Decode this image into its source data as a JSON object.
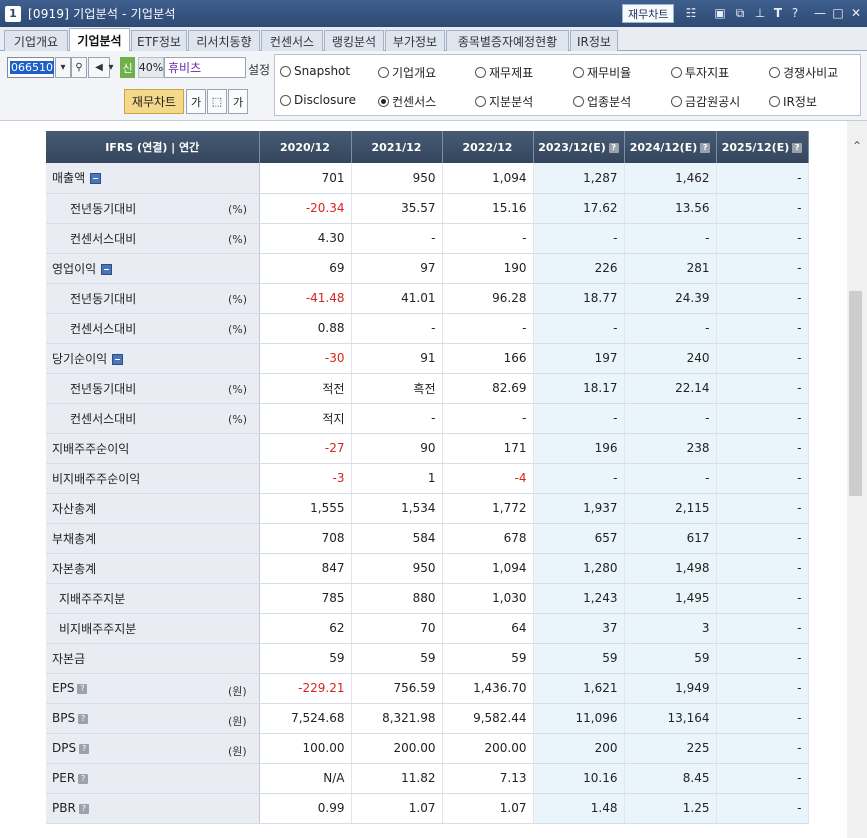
{
  "window": {
    "num": "1",
    "title": "[0919] 기업분석 - 기업분석",
    "chart_button": "재무차트"
  },
  "titlebar_icons": [
    "chart-icon",
    "window-icon",
    "cascade-icon",
    "pin-icon",
    "font-icon",
    "help-icon",
    "minimize-icon",
    "maximize-icon",
    "close-icon"
  ],
  "tabs": [
    "기업개요",
    "기업분석",
    "ETF정보",
    "리서치동향",
    "컨센서스",
    "랭킹분석",
    "부가정보",
    "종목별증자예정현황",
    "IR정보"
  ],
  "active_tab": "기업분석",
  "controls": {
    "code": "066510",
    "new_badge": "신",
    "percent": "40%",
    "stock_name": "휴비츠",
    "setting_label": "설정",
    "fin_chart_button": "재무차트"
  },
  "radios": [
    {
      "label": "Snapshot",
      "selected": false
    },
    {
      "label": "기업개요",
      "selected": false
    },
    {
      "label": "재무제표",
      "selected": false
    },
    {
      "label": "재무비율",
      "selected": false
    },
    {
      "label": "투자지표",
      "selected": false
    },
    {
      "label": "경쟁사비교",
      "selected": false
    },
    {
      "label": "Disclosure",
      "selected": false
    },
    {
      "label": "컨센서스",
      "selected": true
    },
    {
      "label": "지분분석",
      "selected": false
    },
    {
      "label": "업종분석",
      "selected": false
    },
    {
      "label": "금감원공시",
      "selected": false
    },
    {
      "label": "IR정보",
      "selected": false
    }
  ],
  "table": {
    "header_label": "IFRS (연결) | 연간",
    "columns": [
      "2020/12",
      "2021/12",
      "2022/12",
      "2023/12(E)",
      "2024/12(E)",
      "2025/12(E)"
    ],
    "rows": [
      {
        "label": "매출액",
        "indent": 0,
        "unit": "",
        "collapse": true,
        "help": false,
        "values": [
          "701",
          "950",
          "1,094",
          "1,287",
          "1,462",
          "-"
        ]
      },
      {
        "label": "전년동기대비",
        "indent": 2,
        "unit": "(%)",
        "collapse": false,
        "help": false,
        "values": [
          "-20.34",
          "35.57",
          "15.16",
          "17.62",
          "13.56",
          "-"
        ]
      },
      {
        "label": "컨센서스대비",
        "indent": 2,
        "unit": "(%)",
        "collapse": false,
        "help": false,
        "values": [
          "4.30",
          "-",
          "-",
          "-",
          "-",
          "-"
        ]
      },
      {
        "label": "영업이익",
        "indent": 0,
        "unit": "",
        "collapse": true,
        "help": false,
        "values": [
          "69",
          "97",
          "190",
          "226",
          "281",
          "-"
        ]
      },
      {
        "label": "전년동기대비",
        "indent": 2,
        "unit": "(%)",
        "collapse": false,
        "help": false,
        "values": [
          "-41.48",
          "41.01",
          "96.28",
          "18.77",
          "24.39",
          "-"
        ]
      },
      {
        "label": "컨센서스대비",
        "indent": 2,
        "unit": "(%)",
        "collapse": false,
        "help": false,
        "values": [
          "0.88",
          "-",
          "-",
          "-",
          "-",
          "-"
        ]
      },
      {
        "label": "당기순이익",
        "indent": 0,
        "unit": "",
        "collapse": true,
        "help": false,
        "values": [
          "-30",
          "91",
          "166",
          "197",
          "240",
          "-"
        ]
      },
      {
        "label": "전년동기대비",
        "indent": 2,
        "unit": "(%)",
        "collapse": false,
        "help": false,
        "values": [
          "적전",
          "흑전",
          "82.69",
          "18.17",
          "22.14",
          "-"
        ]
      },
      {
        "label": "컨센서스대비",
        "indent": 2,
        "unit": "(%)",
        "collapse": false,
        "help": false,
        "values": [
          "적지",
          "-",
          "-",
          "-",
          "-",
          "-"
        ]
      },
      {
        "label": "지배주주순이익",
        "indent": 0,
        "unit": "",
        "collapse": false,
        "help": false,
        "values": [
          "-27",
          "90",
          "171",
          "196",
          "238",
          "-"
        ]
      },
      {
        "label": "비지배주주순이익",
        "indent": 0,
        "unit": "",
        "collapse": false,
        "help": false,
        "values": [
          "-3",
          "1",
          "-4",
          "-",
          "-",
          "-"
        ]
      },
      {
        "label": "자산총계",
        "indent": 0,
        "unit": "",
        "collapse": false,
        "help": false,
        "values": [
          "1,555",
          "1,534",
          "1,772",
          "1,937",
          "2,115",
          "-"
        ]
      },
      {
        "label": "부채총계",
        "indent": 0,
        "unit": "",
        "collapse": false,
        "help": false,
        "values": [
          "708",
          "584",
          "678",
          "657",
          "617",
          "-"
        ]
      },
      {
        "label": "자본총계",
        "indent": 0,
        "unit": "",
        "collapse": false,
        "help": false,
        "values": [
          "847",
          "950",
          "1,094",
          "1,280",
          "1,498",
          "-"
        ]
      },
      {
        "label": "지배주주지분",
        "indent": 1,
        "unit": "",
        "collapse": false,
        "help": false,
        "values": [
          "785",
          "880",
          "1,030",
          "1,243",
          "1,495",
          "-"
        ]
      },
      {
        "label": "비지배주주지분",
        "indent": 1,
        "unit": "",
        "collapse": false,
        "help": false,
        "values": [
          "62",
          "70",
          "64",
          "37",
          "3",
          "-"
        ]
      },
      {
        "label": "자본금",
        "indent": 0,
        "unit": "",
        "collapse": false,
        "help": false,
        "values": [
          "59",
          "59",
          "59",
          "59",
          "59",
          "-"
        ]
      },
      {
        "label": "EPS",
        "indent": 0,
        "unit": "(원)",
        "collapse": false,
        "help": true,
        "values": [
          "-229.21",
          "756.59",
          "1,436.70",
          "1,621",
          "1,949",
          "-"
        ]
      },
      {
        "label": "BPS",
        "indent": 0,
        "unit": "(원)",
        "collapse": false,
        "help": true,
        "values": [
          "7,524.68",
          "8,321.98",
          "9,582.44",
          "11,096",
          "13,164",
          "-"
        ]
      },
      {
        "label": "DPS",
        "indent": 0,
        "unit": "(원)",
        "collapse": false,
        "help": true,
        "values": [
          "100.00",
          "200.00",
          "200.00",
          "200",
          "225",
          "-"
        ]
      },
      {
        "label": "PER",
        "indent": 0,
        "unit": "",
        "collapse": false,
        "help": true,
        "values": [
          "N/A",
          "11.82",
          "7.13",
          "10.16",
          "8.45",
          "-"
        ]
      },
      {
        "label": "PBR",
        "indent": 0,
        "unit": "",
        "collapse": false,
        "help": true,
        "values": [
          "0.99",
          "1.07",
          "1.07",
          "1.48",
          "1.25",
          "-"
        ]
      }
    ]
  },
  "colors": {
    "negative": "#d8231f",
    "estimate_bg": "#eaf5fb",
    "header_bg": "#3c4f67",
    "label_bg": "#e9edf3"
  }
}
